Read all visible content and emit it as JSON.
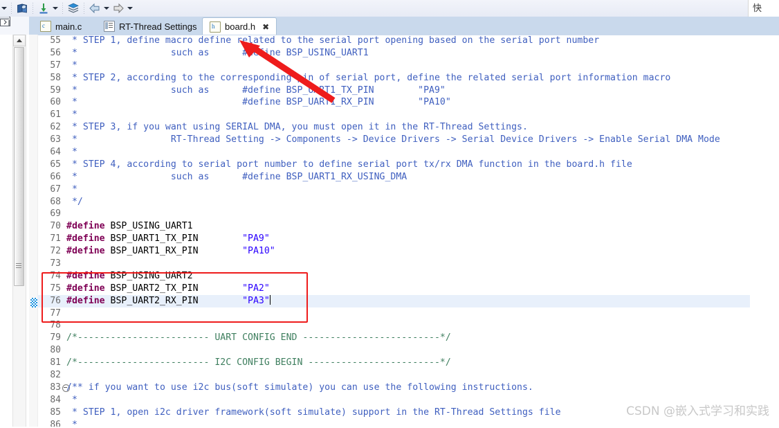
{
  "toolbar": {
    "items": [
      {
        "name": "dropdown-caret-left",
        "icon": "caret-down-icon"
      },
      {
        "name": "open-book-button",
        "icon": "book-icon"
      },
      {
        "name": "download-button",
        "icon": "download-arrow-icon"
      },
      {
        "name": "download-dropdown",
        "icon": "caret-down-icon"
      },
      {
        "name": "layers-button",
        "icon": "layers-icon"
      },
      {
        "name": "back-button",
        "icon": "back-arrow-icon"
      },
      {
        "name": "back-dropdown",
        "icon": "caret-down-icon"
      },
      {
        "name": "forward-button",
        "icon": "forward-arrow-icon"
      },
      {
        "name": "forward-dropdown",
        "icon": "caret-down-icon"
      }
    ],
    "right_label": "快"
  },
  "tabs": [
    {
      "label": "main.c",
      "icon": "c-file-icon",
      "active": false,
      "closeable": false
    },
    {
      "label": "RT-Thread Settings",
      "icon": "settings-icon",
      "active": false,
      "closeable": false
    },
    {
      "label": "board.h",
      "icon": "h-file-icon",
      "active": true,
      "closeable": true,
      "close_glyph": "✖"
    }
  ],
  "editor": {
    "filename": "board.h",
    "current_line": 76,
    "first_visible_line": 55,
    "lines": [
      {
        "n": 55,
        "style": "cmt",
        "text": " * STEP 1, define macro define related to the serial port opening based on the serial port number"
      },
      {
        "n": 56,
        "style": "cmt",
        "text": " *                 such as      #define BSP_USING_UART1"
      },
      {
        "n": 57,
        "style": "cmt",
        "text": " *"
      },
      {
        "n": 58,
        "style": "cmt",
        "text": " * STEP 2, according to the corresponding pin of serial port, define the related serial port information macro"
      },
      {
        "n": 59,
        "style": "cmt",
        "text": " *                 such as      #define BSP_UART1_TX_PIN        \"PA9\""
      },
      {
        "n": 60,
        "style": "cmt",
        "text": " *                              #define BSP_UART1_RX_PIN        \"PA10\""
      },
      {
        "n": 61,
        "style": "cmt",
        "text": " *"
      },
      {
        "n": 62,
        "style": "cmt",
        "text": " * STEP 3, if you want using SERIAL DMA, you must open it in the RT-Thread Settings."
      },
      {
        "n": 63,
        "style": "cmt",
        "text": " *                 RT-Thread Setting -> Components -> Device Drivers -> Serial Device Drivers -> Enable Serial DMA Mode"
      },
      {
        "n": 64,
        "style": "cmt",
        "text": " *"
      },
      {
        "n": 65,
        "style": "cmt",
        "text": " * STEP 4, according to serial port number to define serial port tx/rx DMA function in the board.h file"
      },
      {
        "n": 66,
        "style": "cmt",
        "text": " *                 such as      #define BSP_UART1_RX_USING_DMA"
      },
      {
        "n": 67,
        "style": "cmt",
        "text": " *"
      },
      {
        "n": 68,
        "style": "cmt",
        "text": " */"
      },
      {
        "n": 69,
        "style": "plain",
        "text": ""
      },
      {
        "n": 70,
        "style": "define",
        "kw": "#define",
        "macro": " BSP_USING_UART1",
        "pad": "",
        "value": ""
      },
      {
        "n": 71,
        "style": "define",
        "kw": "#define",
        "macro": " BSP_UART1_TX_PIN",
        "pad": "        ",
        "value": "\"PA9\""
      },
      {
        "n": 72,
        "style": "define",
        "kw": "#define",
        "macro": " BSP_UART1_RX_PIN",
        "pad": "        ",
        "value": "\"PA10\""
      },
      {
        "n": 73,
        "style": "plain",
        "text": ""
      },
      {
        "n": 74,
        "style": "define",
        "kw": "#define",
        "macro": " BSP_USING_UART2",
        "pad": "",
        "value": ""
      },
      {
        "n": 75,
        "style": "define",
        "kw": "#define",
        "macro": " BSP_UART2_TX_PIN",
        "pad": "        ",
        "value": "\"PA2\""
      },
      {
        "n": 76,
        "style": "define",
        "kw": "#define",
        "macro": " BSP_UART2_RX_PIN",
        "pad": "        ",
        "value": "\"PA3\"",
        "caret": true
      },
      {
        "n": 77,
        "style": "plain",
        "text": ""
      },
      {
        "n": 78,
        "style": "plain",
        "text": ""
      },
      {
        "n": 79,
        "style": "cmt2",
        "text": "/*------------------------ UART CONFIG END -------------------------*/"
      },
      {
        "n": 80,
        "style": "plain",
        "text": ""
      },
      {
        "n": 81,
        "style": "cmt2",
        "text": "/*------------------------ I2C CONFIG BEGIN ------------------------*/"
      },
      {
        "n": 82,
        "style": "plain",
        "text": ""
      },
      {
        "n": 83,
        "style": "cmt",
        "fold": true,
        "text": "/** if you want to use i2c bus(soft simulate) you can use the following instructions."
      },
      {
        "n": 84,
        "style": "cmt",
        "text": " *"
      },
      {
        "n": 85,
        "style": "cmt",
        "text": " * STEP 1, open i2c driver framework(soft simulate) support in the RT-Thread Settings file"
      },
      {
        "n": 86,
        "style": "cmt",
        "text": " *"
      }
    ]
  },
  "annotations": {
    "highlight_box": {
      "color": "#ee1c1c",
      "target_lines": "74-77"
    },
    "arrow": {
      "color": "#ee1c1c",
      "points_to": "line-55-comment"
    }
  },
  "watermark": {
    "text": "CSDN @嵌入式学习和实践",
    "color": "#c8c8c8"
  }
}
